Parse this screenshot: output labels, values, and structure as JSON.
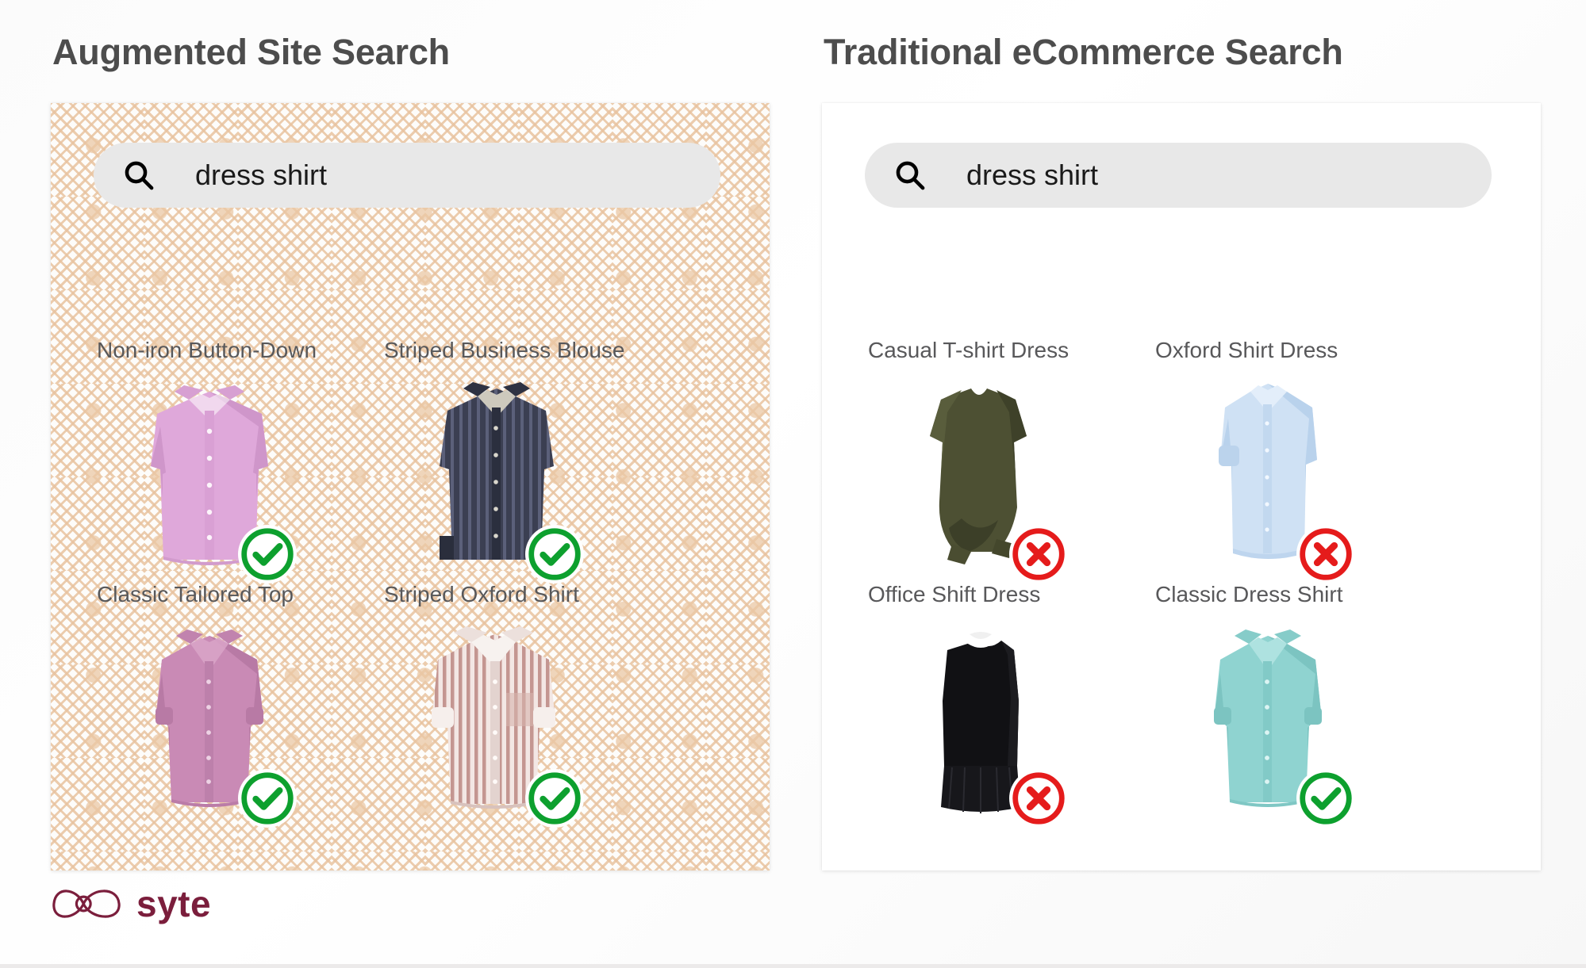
{
  "panels": [
    {
      "id": "augmented",
      "title": "Augmented Site Search",
      "search": {
        "query": "dress shirt",
        "placeholder": "Search",
        "icon": "search-icon"
      },
      "background": "diamond-lattice-pattern",
      "products": [
        {
          "label": "Non-iron Button-Down",
          "status": "match",
          "badge_icon": "check-circle-icon",
          "garment": "button-down-shirt",
          "color": "#dba3d6"
        },
        {
          "label": "Striped Business Blouse",
          "status": "match",
          "badge_icon": "check-circle-icon",
          "garment": "striped-blouse",
          "color": "#3b3f52"
        },
        {
          "label": "Classic Tailored Top",
          "status": "match",
          "badge_icon": "check-circle-icon",
          "garment": "tailored-top",
          "color": "#c57fb0"
        },
        {
          "label": "Striped Oxford Shirt",
          "status": "match",
          "badge_icon": "check-circle-icon",
          "garment": "striped-oxford",
          "color": "#d6a7a2"
        }
      ]
    },
    {
      "id": "traditional",
      "title": "Traditional eCommerce Search",
      "search": {
        "query": "dress shirt",
        "placeholder": "Search",
        "icon": "search-icon"
      },
      "background": "plain-white",
      "products": [
        {
          "label": "Casual T-shirt Dress",
          "status": "mismatch",
          "badge_icon": "x-circle-icon",
          "garment": "tshirt-dress",
          "color": "#4d5033"
        },
        {
          "label": "Oxford Shirt Dress",
          "status": "mismatch",
          "badge_icon": "x-circle-icon",
          "garment": "shirt-dress",
          "color": "#c5dbf0"
        },
        {
          "label": "Office Shift Dress",
          "status": "mismatch",
          "badge_icon": "x-circle-icon",
          "garment": "shift-dress",
          "color": "#111114"
        },
        {
          "label": "Classic Dress Shirt",
          "status": "match",
          "badge_icon": "check-circle-icon",
          "garment": "aqua-dress-shirt",
          "color": "#8fd3d0"
        }
      ]
    }
  ],
  "logo": {
    "name": "syte",
    "mark_icon": "syte-infinity-mark",
    "color": "#7b1e3c"
  },
  "colors": {
    "title": "#4d4d4d",
    "label": "#58585a",
    "search_bg": "#e8e8e8",
    "match": "#0da02e",
    "mismatch": "#e51b1b",
    "pattern": "#e8c3a0",
    "brand": "#7b1e3c"
  }
}
